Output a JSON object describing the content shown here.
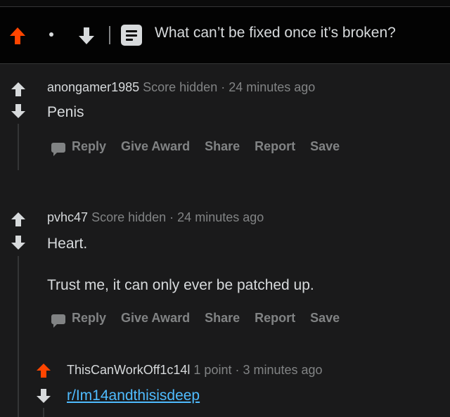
{
  "colors": {
    "upvote_active": "#ff4500",
    "background": "#1a1a1b",
    "text": "#d7dadc",
    "muted": "#818384",
    "link": "#4fbcff"
  },
  "post": {
    "title": "What can’t be fixed once it’s broken?"
  },
  "comments": [
    {
      "author": "anongamer1985",
      "score": "Score hidden",
      "sep": "·",
      "time": "24 minutes ago",
      "body": [
        "Penis"
      ]
    },
    {
      "author": "pvhc47",
      "score": "Score hidden",
      "sep": "·",
      "time": "24 minutes ago",
      "body": [
        "Heart.",
        "Trust me, it can only ever be patched up."
      ]
    },
    {
      "author": "ThisCanWorkOff1c14l",
      "score": "1 point",
      "sep": "·",
      "time": "3 minutes ago",
      "link": "r/Im14andthisisdeep"
    }
  ],
  "actions": {
    "reply": "Reply",
    "give_award": "Give Award",
    "share": "Share",
    "report": "Report",
    "save": "Save"
  }
}
